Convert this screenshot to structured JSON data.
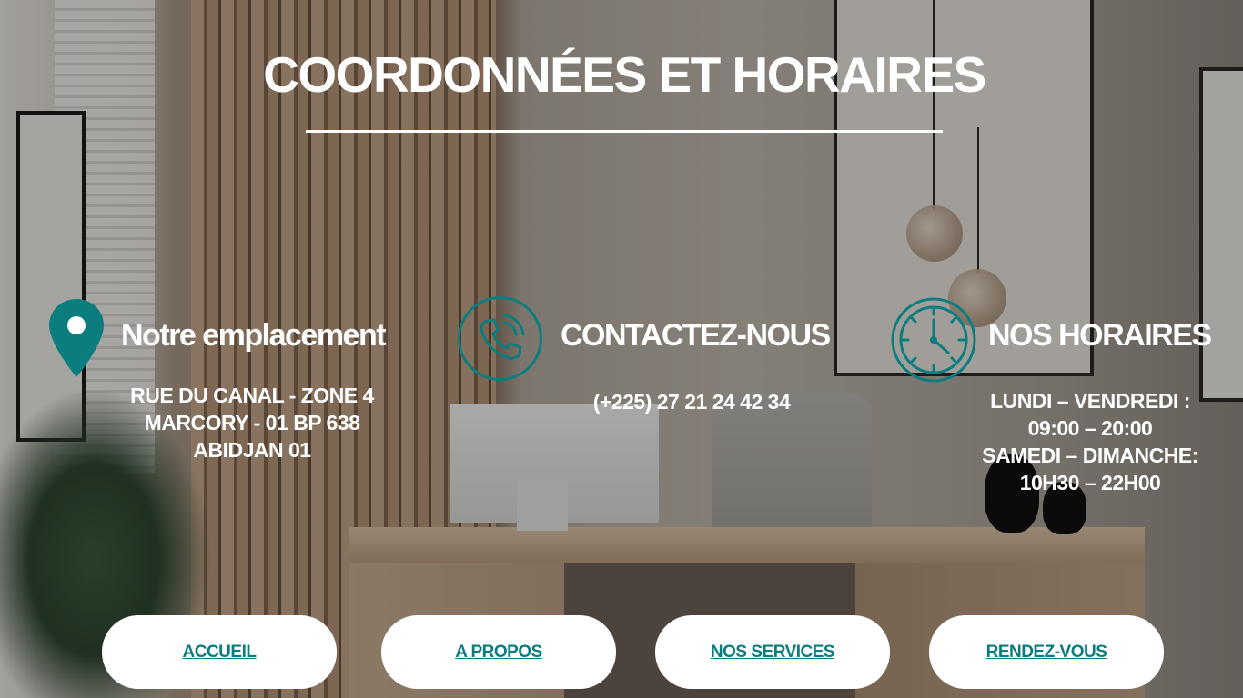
{
  "page": {
    "title": "COORDONNÉES ET HORAIRES",
    "accent_color": "#0c7d7f"
  },
  "location": {
    "icon": "map-pin-icon",
    "heading": "Notre emplacement",
    "lines": [
      "RUE DU CANAL - ZONE 4",
      "MARCORY - 01 BP 638",
      "ABIDJAN 01"
    ]
  },
  "contact": {
    "icon": "phone-call-icon",
    "heading": "CONTACTEZ-NOUS",
    "phone": "(+225) 27 21 24 42 34"
  },
  "hours": {
    "icon": "clock-icon",
    "heading": "NOS HORAIRES",
    "lines": [
      "LUNDI – VENDREDI :",
      "09:00 – 20:00",
      "SAMEDI – DIMANCHE:",
      "10H30 – 22H00"
    ]
  },
  "nav": [
    {
      "label": "ACCUEIL"
    },
    {
      "label": "A PROPOS"
    },
    {
      "label": "NOS SERVICES"
    },
    {
      "label": "RENDEZ-VOUS"
    }
  ]
}
